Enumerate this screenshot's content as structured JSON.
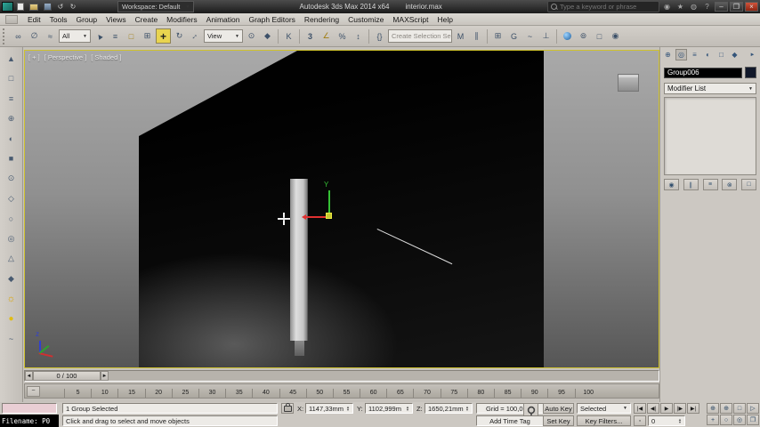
{
  "window": {
    "workspace_label": "Workspace: Default",
    "title": "Autodesk 3ds Max 2014 x64",
    "document": "interior.max",
    "search_placeholder": "Type a keyword or phrase"
  },
  "menus": [
    "Edit",
    "Tools",
    "Group",
    "Views",
    "Create",
    "Modifiers",
    "Animation",
    "Graph Editors",
    "Rendering",
    "Customize",
    "MAXScript",
    "Help"
  ],
  "toolbar": {
    "selection_filter_value": "All",
    "coordinate_system_value": "View",
    "named_sets_placeholder": "Create Selection Se",
    "snap_mode": "3"
  },
  "viewport": {
    "label_menu": "[ + ]",
    "label_pov": "[ Perspective ]",
    "label_shading": "[ Shaded ]",
    "gizmo_axis_label": "Y",
    "world_axis_label": "z"
  },
  "command_panel": {
    "object_name": "Group006",
    "modifier_list_label": "Modifier List"
  },
  "timeline": {
    "slider_label": "0 / 100",
    "ticks": [
      "5",
      "10",
      "15",
      "20",
      "25",
      "30",
      "35",
      "40",
      "45",
      "50",
      "55",
      "60",
      "65",
      "70",
      "75",
      "80",
      "85",
      "90",
      "95",
      "100"
    ]
  },
  "status": {
    "selection_info": "1 Group Selected",
    "prompt": "Click and drag to select and move objects",
    "overlay_filename": "Filename: P0",
    "coord_x_label": "X:",
    "coord_x_value": "1147,33mm",
    "coord_y_label": "Y:",
    "coord_y_value": "1102,999m",
    "coord_z_label": "Z:",
    "coord_z_value": "1650,21mm",
    "grid_info": "Grid = 100,0mm",
    "time_tag": "Add Time Tag",
    "auto_key_label": "Auto Key",
    "set_key_label": "Set Key",
    "key_filter_selected": "Selected",
    "key_filters_label": "Key Filters...",
    "frame_number": "0"
  },
  "icons": {
    "minimize": "–",
    "maximize": "❐",
    "close": "×",
    "dropdown_arrow": "▼",
    "undo": "↺",
    "redo": "↻",
    "slider_left": "◄",
    "slider_right": "►",
    "playback": [
      "|◀",
      "◀|",
      "▶",
      "|▶",
      "▶|"
    ]
  },
  "colors": {
    "viewport_border": "#cfc22e",
    "axis_x": "#e03030",
    "axis_y": "#35c035",
    "axis_z": "#3040d0"
  }
}
